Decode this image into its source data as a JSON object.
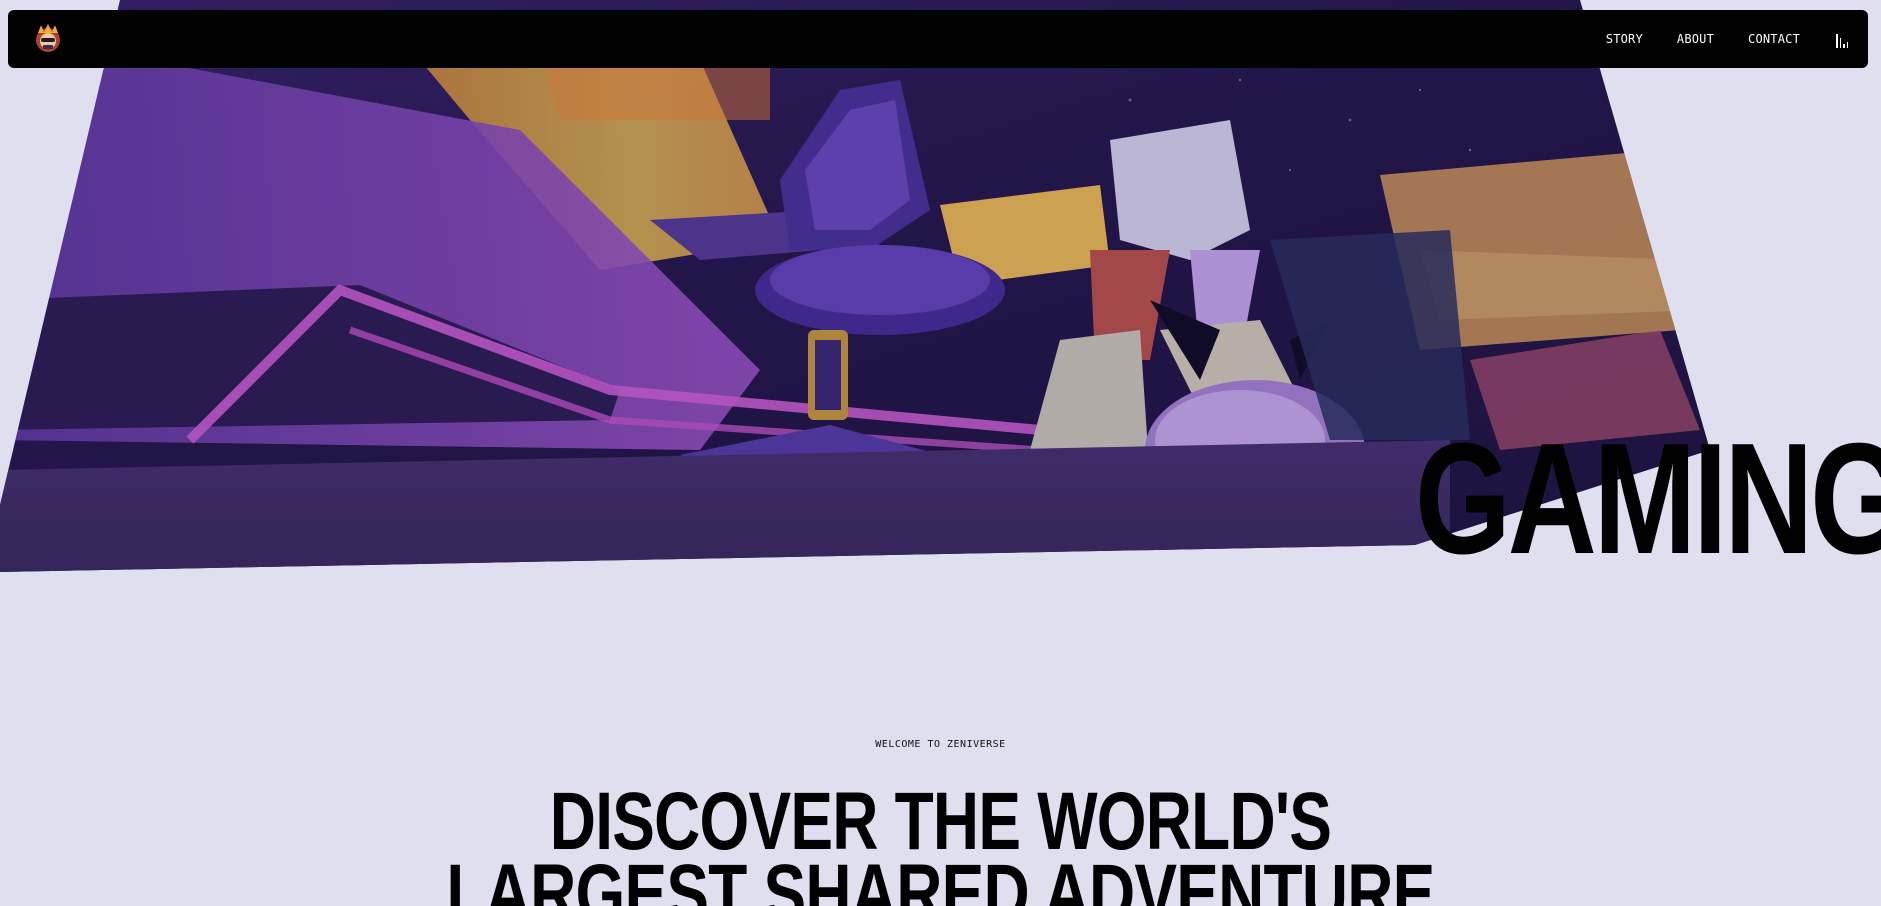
{
  "nav": {
    "logo_icon": "zentry-mascot-logo-icon",
    "links": [
      "STORY",
      "ABOUT",
      "CONTACT"
    ],
    "audio_icon": "audio-bars-icon"
  },
  "hero": {
    "word": "GAMING",
    "scene_icon": "gaming-room-video-frame"
  },
  "welcome": {
    "label": "WELCOME TO ZENIVERSE",
    "headline_line1": "DISCOVER THE WORLD'S",
    "headline_line2": "LARGEST SHARED ADVENTURE"
  },
  "colors": {
    "page_bg": "#dfdff0",
    "nav_bg": "#000000",
    "neon_pink": "#d35bd8",
    "purple_dark": "#2a1a55"
  }
}
